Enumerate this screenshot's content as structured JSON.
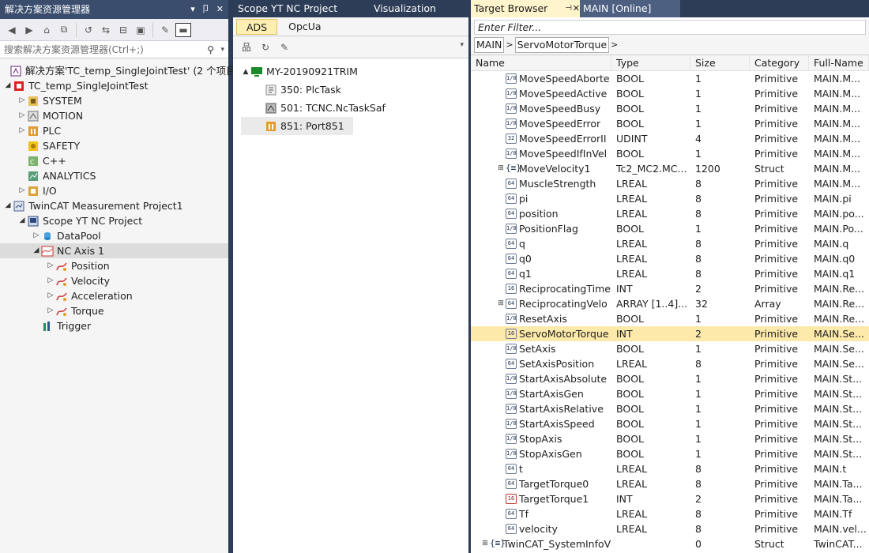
{
  "explorer": {
    "title": "解决方案资源管理器",
    "pin": "▾ 卩 ✕",
    "search_placeholder": "搜索解决方案资源管理器(Ctrl+;)",
    "solution": "解决方案'TC_temp_SingleJointTest' (2 个项目)",
    "items": [
      {
        "label": "TC_temp_SingleJointTest",
        "depth": 0,
        "arrow": "▲",
        "icon": "twincat-project-icon"
      },
      {
        "label": "SYSTEM",
        "depth": 1,
        "arrow": "▷",
        "icon": "system-icon"
      },
      {
        "label": "MOTION",
        "depth": 1,
        "arrow": "▷",
        "icon": "motion-icon"
      },
      {
        "label": "PLC",
        "depth": 1,
        "arrow": "▷",
        "icon": "plc-icon"
      },
      {
        "label": "SAFETY",
        "depth": 1,
        "arrow": "",
        "icon": "safety-icon"
      },
      {
        "label": "C++",
        "depth": 1,
        "arrow": "",
        "icon": "cpp-icon"
      },
      {
        "label": "ANALYTICS",
        "depth": 1,
        "arrow": "",
        "icon": "analytics-icon"
      },
      {
        "label": "I/O",
        "depth": 1,
        "arrow": "▷",
        "icon": "io-icon"
      },
      {
        "label": "TwinCAT Measurement Project1",
        "depth": 0,
        "arrow": "▲",
        "icon": "measurement-project-icon"
      },
      {
        "label": "Scope YT NC Project",
        "depth": 1,
        "arrow": "▲",
        "icon": "scope-icon"
      },
      {
        "label": "DataPool",
        "depth": 2,
        "arrow": "▷",
        "icon": "datapool-icon"
      },
      {
        "label": "NC Axis 1",
        "depth": 2,
        "arrow": "▲",
        "icon": "chart-icon",
        "selected": true
      },
      {
        "label": "Position",
        "depth": 3,
        "arrow": "▷",
        "icon": "channel-icon"
      },
      {
        "label": "Velocity",
        "depth": 3,
        "arrow": "▷",
        "icon": "channel-icon"
      },
      {
        "label": "Acceleration",
        "depth": 3,
        "arrow": "▷",
        "icon": "channel-icon"
      },
      {
        "label": "Torque",
        "depth": 3,
        "arrow": "▷",
        "icon": "channel-icon"
      },
      {
        "label": "Trigger",
        "depth": 2,
        "arrow": "",
        "icon": "trigger-icon"
      }
    ]
  },
  "middle": {
    "tabs": [
      "Scope YT NC Project",
      "Visualization"
    ],
    "subtabs": [
      "ADS",
      "OpcUa"
    ],
    "root": "MY-20190921TRIM",
    "targets": [
      {
        "label": "350: PlcTask",
        "icon": "task-icon"
      },
      {
        "label": "501: TCNC.NcTaskSaf",
        "icon": "nc-task-icon"
      },
      {
        "label": "851: Port851",
        "icon": "port-icon",
        "highlight": true
      }
    ]
  },
  "browser": {
    "tabs": {
      "active": "Target Browser",
      "pin": "⊣",
      "close": "✕",
      "other": "MAIN [Online]"
    },
    "filter_placeholder": "Enter Filter...",
    "breadcrumb": [
      "MAIN",
      "ServoMotorTorque"
    ],
    "columns": [
      "Name",
      "Type",
      "Size",
      "Category",
      "Full-Name"
    ],
    "rows": [
      {
        "name": "MoveSpeedAborte",
        "type": "BOOL",
        "size": "1",
        "cat": "Primitive",
        "full": "MAIN.M...",
        "ic": "1/0"
      },
      {
        "name": "MoveSpeedActive",
        "type": "BOOL",
        "size": "1",
        "cat": "Primitive",
        "full": "MAIN.M...",
        "ic": "1/0"
      },
      {
        "name": "MoveSpeedBusy",
        "type": "BOOL",
        "size": "1",
        "cat": "Primitive",
        "full": "MAIN.M...",
        "ic": "1/0"
      },
      {
        "name": "MoveSpeedError",
        "type": "BOOL",
        "size": "1",
        "cat": "Primitive",
        "full": "MAIN.M...",
        "ic": "1/0"
      },
      {
        "name": "MoveSpeedErrorII",
        "type": "UDINT",
        "size": "4",
        "cat": "Primitive",
        "full": "MAIN.M...",
        "ic": "32"
      },
      {
        "name": "MoveSpeedIfInVel",
        "type": "BOOL",
        "size": "1",
        "cat": "Primitive",
        "full": "MAIN.M...",
        "ic": "1/0"
      },
      {
        "name": "MoveVelocity1",
        "type": "Tc2_MC2.MC...",
        "size": "1200",
        "cat": "Struct",
        "full": "MAIN.M...",
        "ic": "{≡}",
        "exp": true
      },
      {
        "name": "MuscleStrength",
        "type": "LREAL",
        "size": "8",
        "cat": "Primitive",
        "full": "MAIN.M...",
        "ic": "64"
      },
      {
        "name": "pi",
        "type": "LREAL",
        "size": "8",
        "cat": "Primitive",
        "full": "MAIN.pi",
        "ic": "64"
      },
      {
        "name": "position",
        "type": "LREAL",
        "size": "8",
        "cat": "Primitive",
        "full": "MAIN.po...",
        "ic": "64"
      },
      {
        "name": "PositionFlag",
        "type": "BOOL",
        "size": "1",
        "cat": "Primitive",
        "full": "MAIN.Po...",
        "ic": "1/0"
      },
      {
        "name": "q",
        "type": "LREAL",
        "size": "8",
        "cat": "Primitive",
        "full": "MAIN.q",
        "ic": "64"
      },
      {
        "name": "q0",
        "type": "LREAL",
        "size": "8",
        "cat": "Primitive",
        "full": "MAIN.q0",
        "ic": "64"
      },
      {
        "name": "q1",
        "type": "LREAL",
        "size": "8",
        "cat": "Primitive",
        "full": "MAIN.q1",
        "ic": "64"
      },
      {
        "name": "ReciprocatingTime",
        "type": "INT",
        "size": "2",
        "cat": "Primitive",
        "full": "MAIN.Re...",
        "ic": "16"
      },
      {
        "name": "ReciprocatingVelo",
        "type": "ARRAY [1..4]...",
        "size": "32",
        "cat": "Array",
        "full": "MAIN.Re...",
        "ic": "64",
        "exp": true
      },
      {
        "name": "ResetAxis",
        "type": "BOOL",
        "size": "1",
        "cat": "Primitive",
        "full": "MAIN.Re...",
        "ic": "1/0"
      },
      {
        "name": "ServoMotorTorque",
        "type": "INT",
        "size": "2",
        "cat": "Primitive",
        "full": "MAIN.Se...",
        "ic": "16",
        "sel": true
      },
      {
        "name": "SetAxis",
        "type": "BOOL",
        "size": "1",
        "cat": "Primitive",
        "full": "MAIN.Se...",
        "ic": "1/0"
      },
      {
        "name": "SetAxisPosition",
        "type": "LREAL",
        "size": "8",
        "cat": "Primitive",
        "full": "MAIN.Se...",
        "ic": "64"
      },
      {
        "name": "StartAxisAbsolute",
        "type": "BOOL",
        "size": "1",
        "cat": "Primitive",
        "full": "MAIN.St...",
        "ic": "1/0"
      },
      {
        "name": "StartAxisGen",
        "type": "BOOL",
        "size": "1",
        "cat": "Primitive",
        "full": "MAIN.St...",
        "ic": "1/0"
      },
      {
        "name": "StartAxisRelative",
        "type": "BOOL",
        "size": "1",
        "cat": "Primitive",
        "full": "MAIN.St...",
        "ic": "1/0"
      },
      {
        "name": "StartAxisSpeed",
        "type": "BOOL",
        "size": "1",
        "cat": "Primitive",
        "full": "MAIN.St...",
        "ic": "1/0"
      },
      {
        "name": "StopAxis",
        "type": "BOOL",
        "size": "1",
        "cat": "Primitive",
        "full": "MAIN.St...",
        "ic": "1/0"
      },
      {
        "name": "StopAxisGen",
        "type": "BOOL",
        "size": "1",
        "cat": "Primitive",
        "full": "MAIN.St...",
        "ic": "1/0"
      },
      {
        "name": "t",
        "type": "LREAL",
        "size": "8",
        "cat": "Primitive",
        "full": "MAIN.t",
        "ic": "64"
      },
      {
        "name": "TargetTorque0",
        "type": "LREAL",
        "size": "8",
        "cat": "Primitive",
        "full": "MAIN.Ta...",
        "ic": "64"
      },
      {
        "name": "TargetTorque1",
        "type": "INT",
        "size": "2",
        "cat": "Primitive",
        "full": "MAIN.Ta...",
        "ic": "16",
        "warn": true
      },
      {
        "name": "Tf",
        "type": "LREAL",
        "size": "8",
        "cat": "Primitive",
        "full": "MAIN.Tf",
        "ic": "64"
      },
      {
        "name": "velocity",
        "type": "LREAL",
        "size": "8",
        "cat": "Primitive",
        "full": "MAIN.vel...",
        "ic": "64"
      },
      {
        "name": "TwinCAT_SystemInfoV",
        "type": "",
        "size": "0",
        "cat": "Struct",
        "full": "TwinCAT...",
        "ic": "{≡}",
        "exp": true,
        "top": true
      }
    ]
  },
  "colors": {
    "accent": "#2d3c57",
    "selection": "#fde9a9",
    "tab_active": "#fff4cc"
  }
}
